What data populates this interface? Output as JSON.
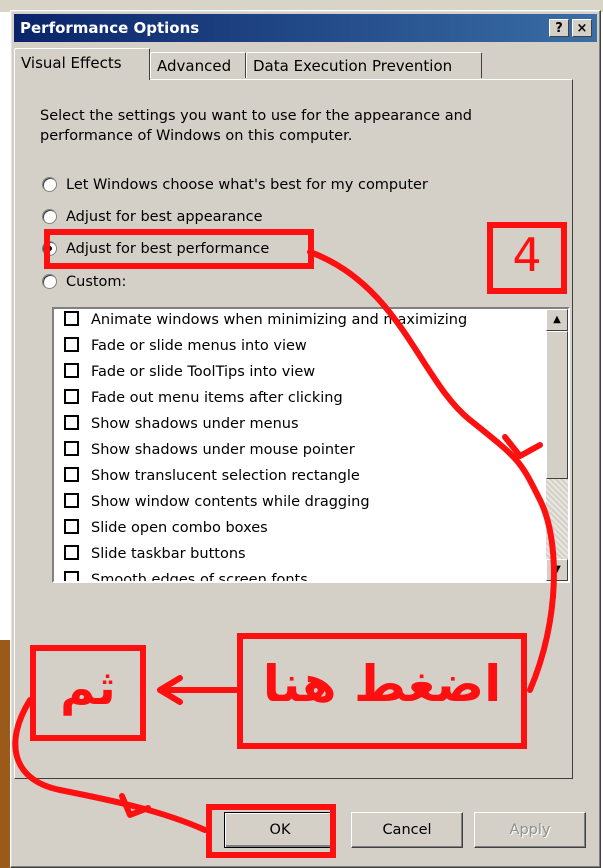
{
  "window": {
    "title": "Performance Options",
    "help_label": "?",
    "close_label": "×"
  },
  "tabs": [
    {
      "label": "Visual Effects",
      "active": true
    },
    {
      "label": "Advanced",
      "active": false
    },
    {
      "label": "Data Execution Prevention",
      "active": false
    }
  ],
  "description": "Select the settings you want to use for the appearance and performance of Windows on this computer.",
  "options": [
    {
      "label": "Let Windows choose what's best for my computer",
      "checked": false
    },
    {
      "label": "Adjust for best appearance",
      "checked": false
    },
    {
      "label": "Adjust for best performance",
      "checked": true
    },
    {
      "label": "Custom:",
      "checked": false
    }
  ],
  "effects": [
    {
      "label": "Animate windows when minimizing and maximizing",
      "checked": false
    },
    {
      "label": "Fade or slide menus into view",
      "checked": false
    },
    {
      "label": "Fade or slide ToolTips into view",
      "checked": false
    },
    {
      "label": "Fade out menu items after clicking",
      "checked": false
    },
    {
      "label": "Show shadows under menus",
      "checked": false
    },
    {
      "label": "Show shadows under mouse pointer",
      "checked": false
    },
    {
      "label": "Show translucent selection rectangle",
      "checked": false
    },
    {
      "label": "Show window contents while dragging",
      "checked": false
    },
    {
      "label": "Slide open combo boxes",
      "checked": false
    },
    {
      "label": "Slide taskbar buttons",
      "checked": false
    },
    {
      "label": "Smooth edges of screen fonts",
      "checked": false
    }
  ],
  "buttons": {
    "ok": "OK",
    "cancel": "Cancel",
    "apply": "Apply"
  },
  "annotations": {
    "step_number": "4",
    "press_here": "اضغط هنا",
    "then": "ثم",
    "color": "#ff1010"
  }
}
